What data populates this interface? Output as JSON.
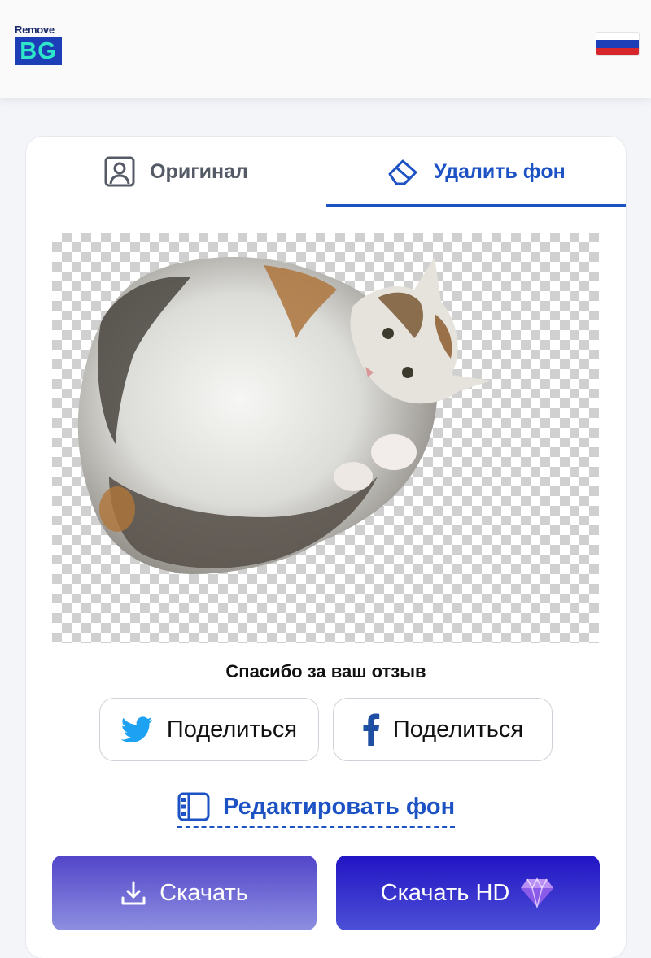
{
  "header": {
    "logo_top": "Remove",
    "logo_bottom": "BG",
    "language_flag": "russia-flag-icon"
  },
  "tabs": [
    {
      "label": "Оригинал",
      "icon": "portrait-icon",
      "active": false
    },
    {
      "label": "Удалить фон",
      "icon": "eraser-icon",
      "active": true
    }
  ],
  "preview": {
    "subject": "cat-cutout-image",
    "background": "transparency-checkerboard"
  },
  "feedback": {
    "thanks": "Спасибо за ваш отзыв"
  },
  "share": {
    "twitter_label": "Поделиться",
    "facebook_label": "Поделиться"
  },
  "edit_background": {
    "label": "Редактировать фон",
    "icon": "film-strip-icon"
  },
  "actions": {
    "download_label": "Скачать",
    "download_hd_label": "Скачать HD",
    "download_icon": "download-icon",
    "hd_icon": "diamond-icon"
  },
  "colors": {
    "accent": "#1d52c4",
    "twitter": "#1da1f2",
    "facebook": "#1e4fa3",
    "download_button": "#5245c9",
    "download_hd_button": "#2214c4"
  }
}
